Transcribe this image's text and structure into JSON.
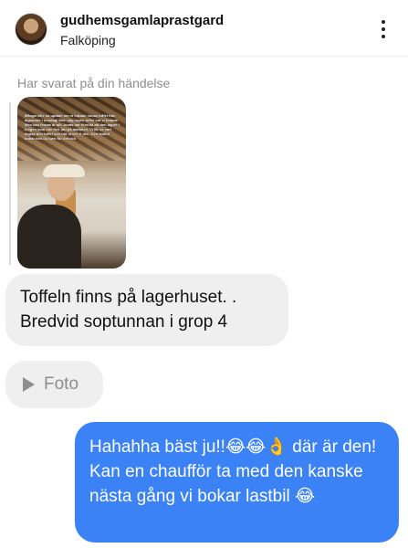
{
  "header": {
    "username": "gudhemsgamlaprastgard",
    "location": "Falköping",
    "avatar_icon": "avatar",
    "menu_icon": "kebab-menu-icon"
  },
  "story_reply": {
    "label": "Har svarat på din händelse",
    "caption": "Många ville ha update om vi hittade Jonas toffel från lagsmöte i onsdag! Men säg ingen toffel var vi hittade. Men kan finnas är allt Jonas har försökt att den lagret i helgen som inte fick ditt på lastbilen. Vi får se vart lagras den toffel och när vi vet vi den. Den lastbil bokar den du igen för det och"
  },
  "messages": {
    "incoming_text": "Toffeln finns på lagerhuset. . Bredvid soptunnan i grop 4",
    "photo_label": "Foto",
    "outgoing_text": "Hahahha bäst ju!!😂😂👌 där är den! Kan en chaufför ta med den kanske nästa gång vi bokar lastbil 😂"
  },
  "colors": {
    "outgoing_bubble": "#3b82f6",
    "incoming_bubble": "#efefef",
    "muted_text": "#8e8e8e"
  }
}
